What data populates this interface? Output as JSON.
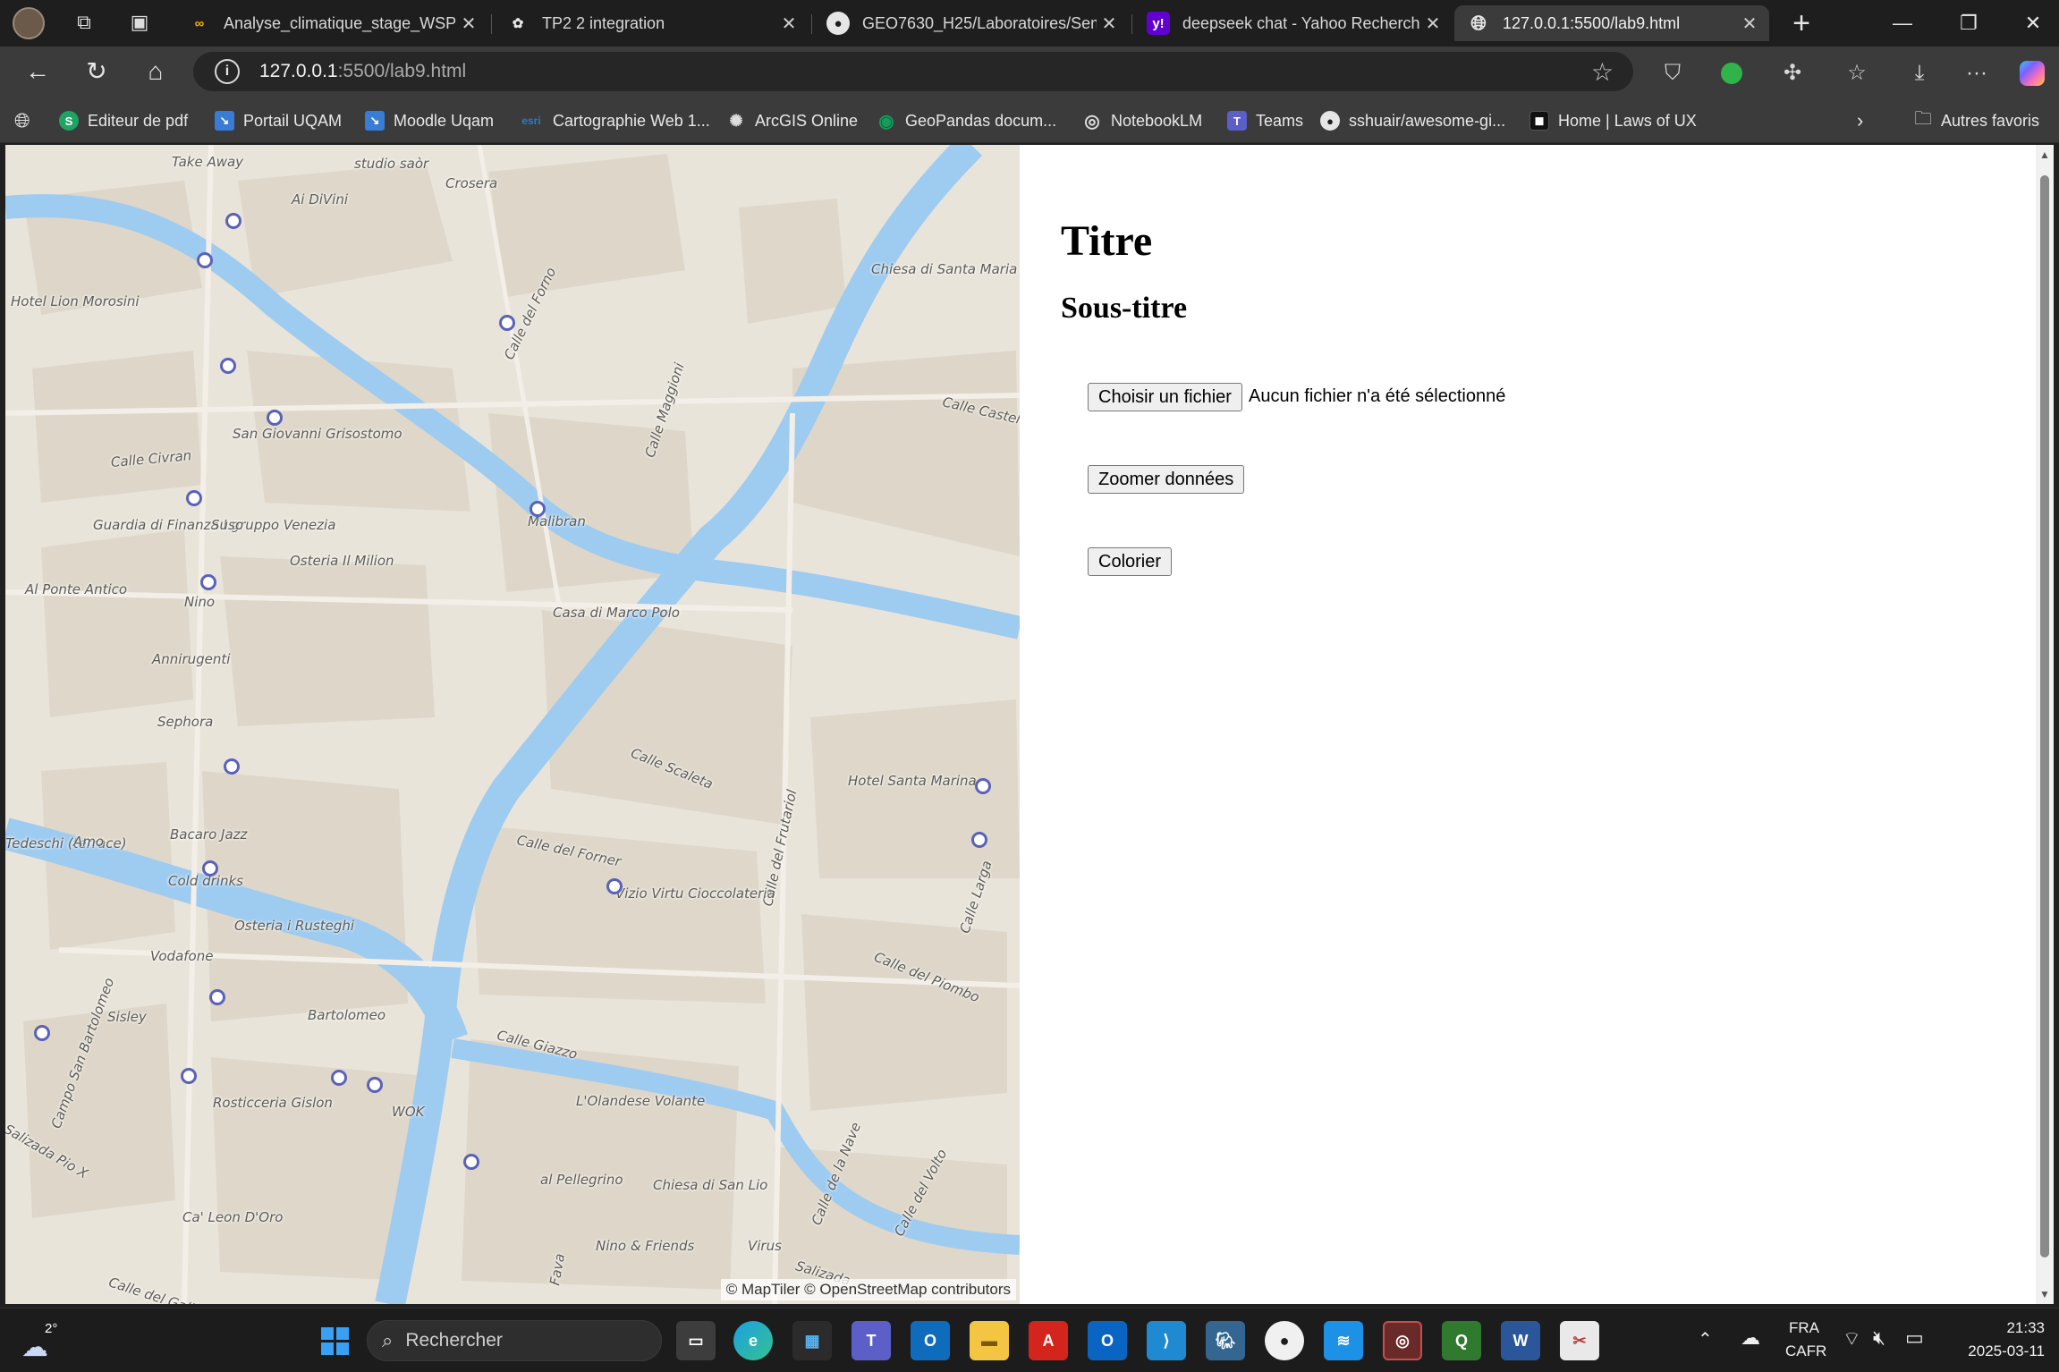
{
  "browser": {
    "tabs": [
      {
        "title": "Analyse_climatique_stage_WSP - ",
        "icon": "colab-icon",
        "color": "#f9ab00",
        "active": false
      },
      {
        "title": "TP2 2 integration",
        "icon": "chatgpt-icon",
        "color": "#d8d8d8",
        "active": false
      },
      {
        "title": "GEO7630_H25/Laboratoires/Sem",
        "icon": "github-icon",
        "color": "#d8d8d8",
        "active": false
      },
      {
        "title": "deepseek chat - Yahoo Recherche",
        "icon": "yahoo-icon",
        "color": "#6001d2",
        "active": false
      },
      {
        "title": "127.0.0.1:5500/lab9.html",
        "icon": "globe-icon",
        "color": "#d8d8d8",
        "active": true
      }
    ],
    "new_tab_glyph": "+",
    "window_controls": {
      "minimize": "—",
      "restore": "❐",
      "close": "✕"
    },
    "address": {
      "host": "127.0.0.1",
      "rest": ":5500/lab9.html"
    },
    "bookmarks": [
      {
        "label": "Editeur de pdf",
        "icon": "S",
        "color": "#1fa463"
      },
      {
        "label": "Portail UQAM",
        "icon": "↘",
        "color": "#3a7bd5"
      },
      {
        "label": "Moodle Uqam",
        "icon": "↘",
        "color": "#3a7bd5"
      },
      {
        "label": "Cartographie Web 1...",
        "icon": "esri",
        "color": "#2c7ac9"
      },
      {
        "label": "ArcGIS Online",
        "icon": "✺",
        "color": "#555555"
      },
      {
        "label": "GeoPandas docum...",
        "icon": "◉",
        "color": "#139c5a"
      },
      {
        "label": "NotebookLM",
        "icon": "◎",
        "color": "#555555"
      },
      {
        "label": "Teams",
        "icon": "T",
        "color": "#5b5fc7"
      },
      {
        "label": "sshuair/awesome-gi...",
        "icon": "●",
        "color": "#333333"
      },
      {
        "label": "Home | Laws of UX",
        "icon": "◼",
        "color": "#111111"
      }
    ],
    "other_favorites": "Autres favoris"
  },
  "page": {
    "title": "Titre",
    "subtitle": "Sous-titre",
    "file_button": "Choisir un fichier",
    "file_status": "Aucun fichier n'a été sélectionné",
    "zoom_button": "Zoomer données",
    "color_button": "Colorier"
  },
  "map": {
    "attribution": "© MapTiler © OpenStreetMap contributors",
    "labels": [
      "Take Away",
      "studio saòr",
      "Crosera",
      "Ai DiVini",
      "Hotel Lion Morosini",
      "Calle del Forno",
      "Chiesa di Santa Maria dei Miracoli",
      "Calle Maggioni",
      "San Giovanni Grisostomo",
      "Calle Civran",
      "Calle Castelli",
      "Malibran",
      "Guardia di Finanza I gruppo Venezia",
      "Suso",
      "Osteria Il Milion",
      "Al Ponte Antico",
      "Nino",
      "Casa di Marco Polo",
      "Annirugenti",
      "Sephora",
      "Calle Scaleta",
      "Hotel Santa Marina",
      "Tedeschi (terrace)",
      "Amo",
      "Bacaro Jazz",
      "Calle del Forner",
      "Calle del Frutariol",
      "Cold drinks",
      "Vizio Virtu Cioccolateria",
      "Osteria i Rusteghi",
      "Calle Larga",
      "Vodafone",
      "Calle del Piombo",
      "Bartolomeo",
      "Sisley",
      "Calle Giazzo",
      "Rosticceria Gislon",
      "WOK",
      "L'Olandese Volante",
      "Campo San Bartolomeo",
      "Salizada Pio X",
      "al Pellegrino",
      "Chiesa di San Lio",
      "Calle de la Nave",
      "Calle del Volto",
      "Ca' Leon D'Oro",
      "Nino & Friends",
      "Virus",
      "Calle del Galiazzo",
      "Salizada",
      "Fava"
    ]
  },
  "taskbar": {
    "weather": "2°",
    "search_placeholder": "Rechercher",
    "language": "FRA",
    "layout": "CAFR",
    "time": "21:33",
    "date": "2025-03-11"
  }
}
